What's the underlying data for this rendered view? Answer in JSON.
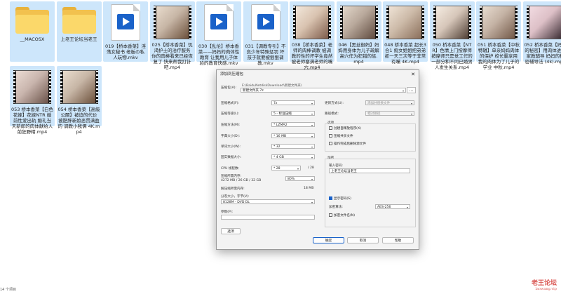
{
  "files": [
    {
      "type": "folder",
      "label": "__MACOSX"
    },
    {
      "type": "folder",
      "label": "上老王论坛当老王"
    },
    {
      "type": "doc",
      "label": "019【桥本香菜】淫荡女秘书 老板の私人玩物.mkv"
    },
    {
      "type": "video",
      "label": "025【桥本香菜】饥渴护士的治疗服务 你的肉棒看来已经恢复了 快来帮我打针吧.mp4"
    },
    {
      "type": "doc",
      "label": "030【乱伦】桥本香菜——妈妈的肉体性教育 让我用儿子体验的教育快感.mkv"
    },
    {
      "type": "doc",
      "label": "031【调教专引】不良少年特殊惩罚 坏孩子就要被狠狠调教.mkv"
    },
    {
      "type": "video",
      "label": "038【桥本香菜】老师的肉棒调教 被调教的性的坏学生竟然被老师塞满老师的嘴穴.mp4"
    },
    {
      "type": "video",
      "label": "046【黑丝御妈】妈妈用身体为儿子疏解 高穴作为犯错的惩.mp4"
    },
    {
      "type": "video",
      "label": "048 桥本香菜 超长3合1 痴女姐姐把弟弟抓一天三次等于非常有嘴 4K.mp4"
    },
    {
      "type": "video",
      "label": "050 桥本香菜【NTR】色情上门按摩师 按摩师只是觉工作的一部分和不同已婚男人发生关系.mp4"
    },
    {
      "type": "video",
      "label": "051 桥本香菜【中秋特辑】单亲妈妈肉体的保护 校长霸享用我的肉体为了儿子的学业 中秋.mp4"
    },
    {
      "type": "video",
      "label": "052 桥本香菜【妈妈的秘密】用肉体进行家教辅导 妈妈的秘密辅导法 (4k).mp4"
    },
    {
      "type": "video",
      "label": "053 桥本香菜【白色花嫁】花嫁NTR 婚前性爱出轨 婚礼当天新郎的肉体献给人前狂野精.mp4"
    },
    {
      "type": "video",
      "label": "054 桥本香菜【高級公關】被迫的代价 被肥胖新娘恶贯满盈的 调教小我俩 4K.mp4"
    }
  ],
  "dialog": {
    "title": "添加到压缩包",
    "close_glyph": "✕",
    "archive_label": "压缩包(A):",
    "archive_path_hint": "E:\\BaiduNetdiskDownload\\新建文件夹\\",
    "archive_value": "新建文件夹.7z",
    "browse_label": "...",
    "format_label": "压缩格式(F):",
    "format_value": "7z",
    "level_label": "压缩等级(L):",
    "level_value": "5 - 标准压缩",
    "method_label": "压缩方法(M):",
    "method_value": "* LZMA2",
    "dict_label": "字典大小(D):",
    "dict_value": "* 16 MB",
    "word_label": "单词大小(W):",
    "word_value": "* 32",
    "solid_label": "固实数据大小:",
    "solid_value": "* 4 GB",
    "threads_label": "CPU 线程数:",
    "threads_value": "* 28",
    "threads_max": "/ 28",
    "mem_label": "压缩所需内存:",
    "mem_value": "4272 MB / 26 GB / 32 GB",
    "mem_pct": "80%",
    "decomp_label": "解压缩所需内存:",
    "decomp_value": "18 MB",
    "split_label": "分卷大小，字节(V):",
    "split_value": "8128M - DVD DL",
    "params_label": "参数(P):",
    "options_button": "选项",
    "update_label": "更新方式(U):",
    "update_value": "添加并替换文件",
    "path_label": "路径模式:",
    "path_value": "相对路径",
    "options_group": "选项",
    "opt_sfx": "创建自释放程序(X)",
    "opt_shared": "压缩共享文件",
    "opt_delete": "操作完成后删除源文件",
    "encrypt_group": "加密",
    "password_label": "输入密码:",
    "password_value": "上老王论坛当老王",
    "show_password": "显示密码(S)",
    "encrypt_method_label": "加密算法:",
    "encrypt_method_value": "AES-256",
    "encrypt_names": "加密文件名(N)",
    "ok_button": "确定",
    "cancel_button": "取消",
    "help_button": "帮助"
  },
  "watermark": {
    "title": "老王论坛",
    "sub": "laowang.vip"
  },
  "status_bar": "14 个项目"
}
